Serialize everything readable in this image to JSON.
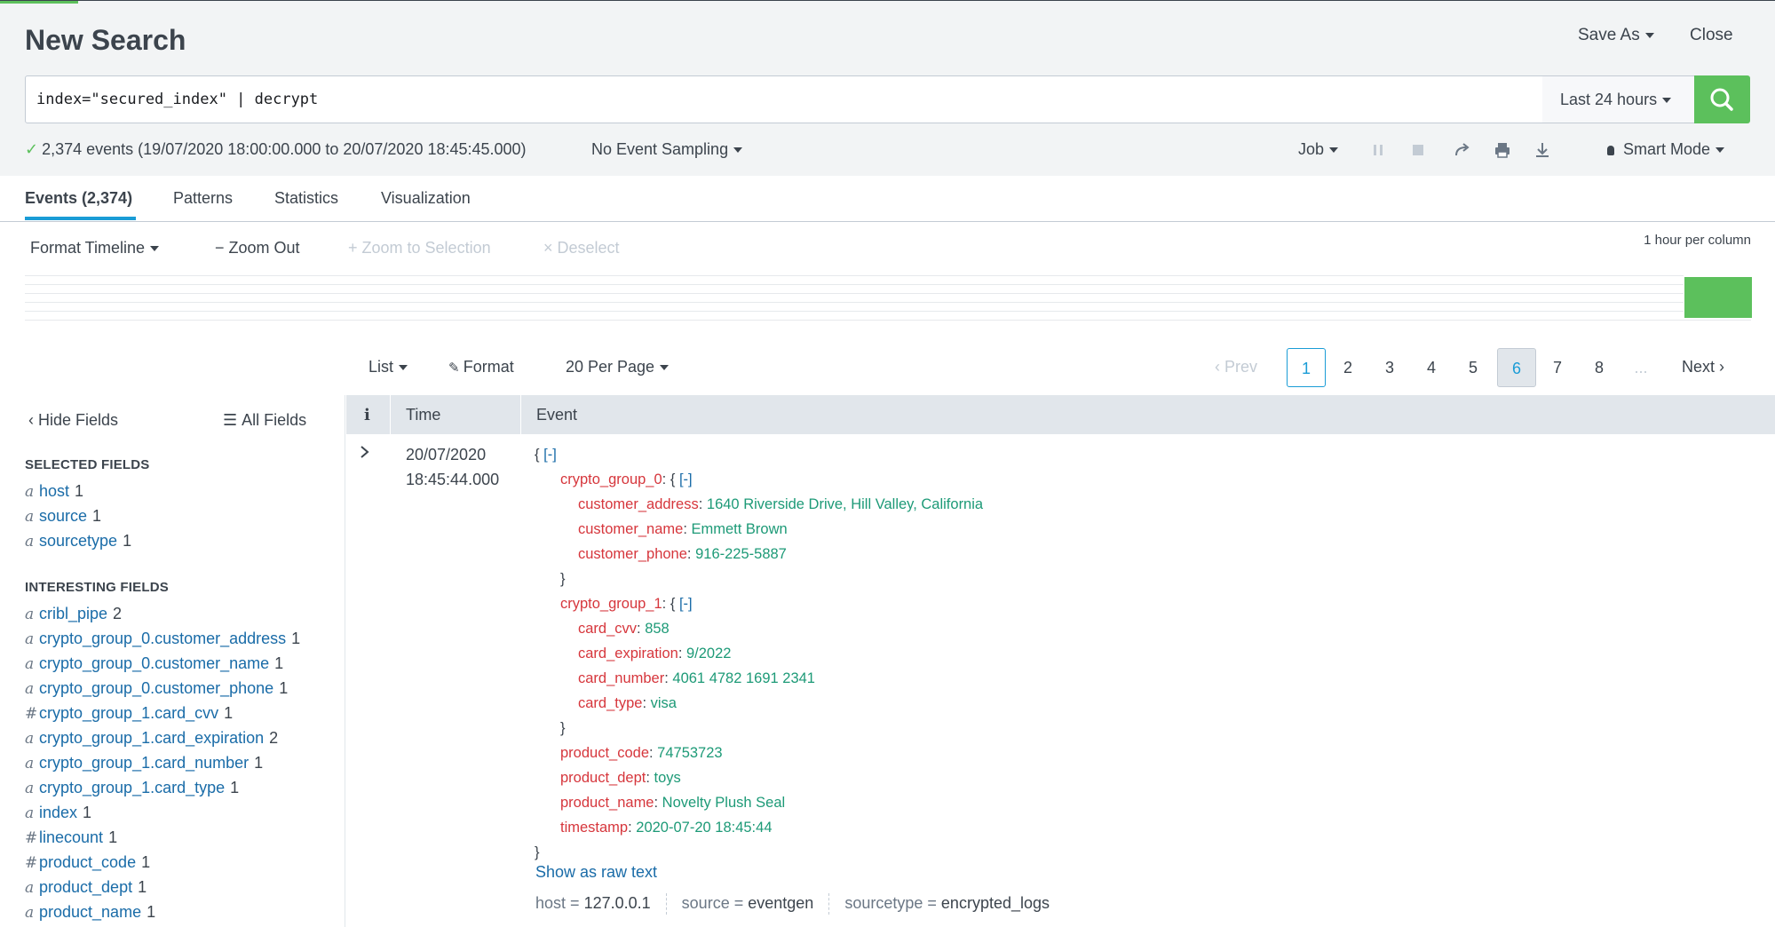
{
  "header": {
    "title": "New Search",
    "save_as": "Save As",
    "close": "Close"
  },
  "search": {
    "query": "index=\"secured_index\" | decrypt",
    "time_range": "Last 24 hours"
  },
  "status": {
    "summary": "2,374 events (19/07/2020 18:00:00.000 to 20/07/2020 18:45:45.000)",
    "sampling": "No Event Sampling",
    "job": "Job",
    "mode": "Smart Mode"
  },
  "tabs": [
    {
      "label": "Events (2,374)",
      "active": true
    },
    {
      "label": "Patterns"
    },
    {
      "label": "Statistics"
    },
    {
      "label": "Visualization"
    }
  ],
  "timeline": {
    "format": "Format Timeline",
    "zoom_out": "Zoom Out",
    "zoom_selection": "Zoom to Selection",
    "deselect": "Deselect",
    "scale": "1 hour per column",
    "bar_color": "#5cc05c"
  },
  "results_controls": {
    "view": "List",
    "format": "Format",
    "per_page": "20 Per Page",
    "prev": "Prev",
    "next": "Next",
    "pages": [
      "1",
      "2",
      "3",
      "4",
      "5",
      "6",
      "7",
      "8",
      "..."
    ],
    "current_page": "1",
    "highlighted_page": "6"
  },
  "sidebar": {
    "hide_fields": "Hide Fields",
    "all_fields": "All Fields",
    "selected_heading": "SELECTED FIELDS",
    "interesting_heading": "INTERESTING FIELDS",
    "selected": [
      {
        "type": "a",
        "name": "host",
        "count": "1"
      },
      {
        "type": "a",
        "name": "source",
        "count": "1"
      },
      {
        "type": "a",
        "name": "sourcetype",
        "count": "1"
      }
    ],
    "interesting": [
      {
        "type": "a",
        "name": "cribl_pipe",
        "count": "2"
      },
      {
        "type": "a",
        "name": "crypto_group_0.customer_address",
        "count": "1"
      },
      {
        "type": "a",
        "name": "crypto_group_0.customer_name",
        "count": "1"
      },
      {
        "type": "a",
        "name": "crypto_group_0.customer_phone",
        "count": "1"
      },
      {
        "type": "#",
        "name": "crypto_group_1.card_cvv",
        "count": "1"
      },
      {
        "type": "a",
        "name": "crypto_group_1.card_expiration",
        "count": "2"
      },
      {
        "type": "a",
        "name": "crypto_group_1.card_number",
        "count": "1"
      },
      {
        "type": "a",
        "name": "crypto_group_1.card_type",
        "count": "1"
      },
      {
        "type": "a",
        "name": "index",
        "count": "1"
      },
      {
        "type": "#",
        "name": "linecount",
        "count": "1"
      },
      {
        "type": "#",
        "name": "product_code",
        "count": "1"
      },
      {
        "type": "a",
        "name": "product_dept",
        "count": "1"
      },
      {
        "type": "a",
        "name": "product_name",
        "count": "1"
      }
    ]
  },
  "table": {
    "col_info": "i",
    "col_time": "Time",
    "col_event": "Event"
  },
  "event": {
    "date": "20/07/2020",
    "time": "18:45:44.000",
    "collapse_label": "[-]",
    "groups": [
      {
        "key": "crypto_group_0",
        "fields": [
          {
            "key": "customer_address",
            "value": "1640 Riverside Drive, Hill Valley, California"
          },
          {
            "key": "customer_name",
            "value": "Emmett Brown"
          },
          {
            "key": "customer_phone",
            "value": "916-225-5887"
          }
        ]
      },
      {
        "key": "crypto_group_1",
        "fields": [
          {
            "key": "card_cvv",
            "value": "858"
          },
          {
            "key": "card_expiration",
            "value": "9/2022"
          },
          {
            "key": "card_number",
            "value": "4061 4782 1691 2341"
          },
          {
            "key": "card_type",
            "value": "visa"
          }
        ]
      }
    ],
    "fields": [
      {
        "key": "product_code",
        "value": "74753723"
      },
      {
        "key": "product_dept",
        "value": "toys"
      },
      {
        "key": "product_name",
        "value": "Novelty Plush Seal"
      },
      {
        "key": "timestamp",
        "value": "2020-07-20 18:45:44"
      }
    ],
    "show_raw": "Show as raw text",
    "meta": [
      {
        "label": "host =",
        "value": "127.0.0.1"
      },
      {
        "label": "source =",
        "value": "eventgen"
      },
      {
        "label": "sourcetype =",
        "value": "encrypted_logs"
      }
    ]
  }
}
